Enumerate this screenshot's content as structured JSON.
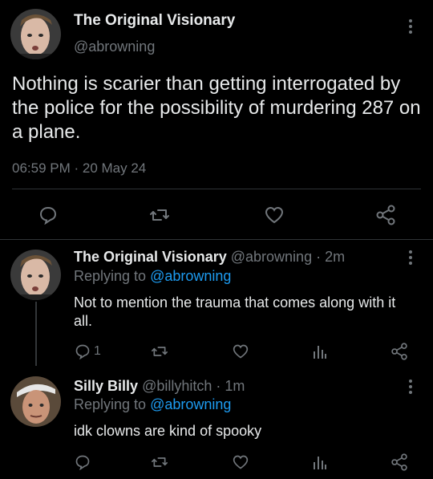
{
  "main_tweet": {
    "author_name": "The Original Visionary",
    "handle": "@abrowning",
    "text": "Nothing is scarier than getting interrogated by the police for the possibility of murdering 287 on a plane.",
    "timestamp": "06:59 PM · 20 May 24",
    "actions": [
      "reply-icon",
      "retweet-icon",
      "like-icon",
      "share-icon"
    ]
  },
  "replies": [
    {
      "author_name": "The Original Visionary",
      "handle": "@abrowning",
      "time": "· 2m",
      "replying_to_label": "Replying to",
      "replying_to_handle": "@abrowning",
      "text": "Not to mention the trauma that comes along with it all.",
      "reply_count": "1"
    },
    {
      "author_name": "Silly Billy",
      "handle": "@billyhitch",
      "time": "· 1m",
      "replying_to_label": "Replying to",
      "replying_to_handle": "@abrowning",
      "text": "idk clowns are kind of spooky",
      "reply_count": ""
    }
  ],
  "colors": {
    "background": "#000000",
    "text": "#e7e9ea",
    "muted": "#71767b",
    "link": "#1d9bf0",
    "divider": "#2f3336"
  }
}
